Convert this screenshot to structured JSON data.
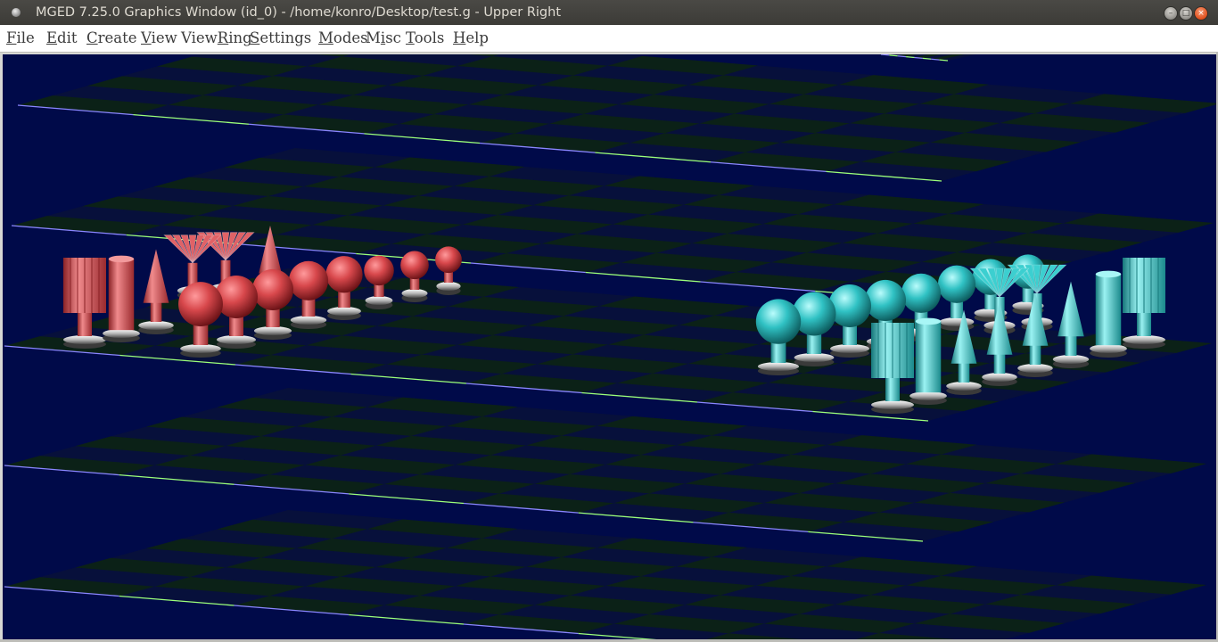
{
  "window": {
    "title": "MGED 7.25.0 Graphics Window (id_0) - /home/konro/Desktop/test.g - Upper Right",
    "buttons": {
      "close": "close-icon",
      "minimize": "minimize-icon",
      "maximize": "maximize-icon"
    }
  },
  "menu": [
    {
      "pre": "",
      "key": "F",
      "post": "ile"
    },
    {
      "pre": "",
      "key": "E",
      "post": "dit"
    },
    {
      "pre": "",
      "key": "C",
      "post": "reate"
    },
    {
      "pre": "",
      "key": "V",
      "post": "iew"
    },
    {
      "pre": "View",
      "key": "R",
      "post": "ing"
    },
    {
      "pre": "",
      "key": "S",
      "post": "ettings"
    },
    {
      "pre": "",
      "key": "M",
      "post": "odes"
    },
    {
      "pre": "M",
      "key": "i",
      "post": "sc"
    },
    {
      "pre": "",
      "key": "T",
      "post": "ools"
    },
    {
      "pre": "",
      "key": "H",
      "post": "elp"
    }
  ],
  "scene": {
    "background": "#000a49",
    "board_dark": "#07103b",
    "board_light": "#0c2414",
    "axis_x_color": "#8a86ff",
    "axis_y_color": "#9cff7a",
    "red_team_color": "#d8585c",
    "cyan_team_color": "#34c6c8",
    "base_color": "#d8d8d8",
    "boards": 6,
    "red_pieces": 16,
    "cyan_pieces": 16
  }
}
